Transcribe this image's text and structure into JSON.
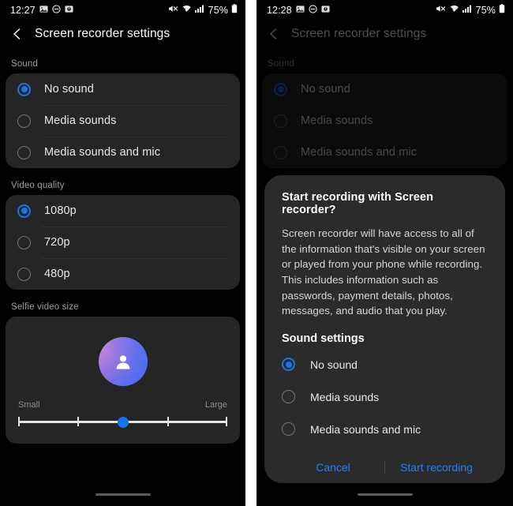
{
  "panels": {
    "left": {
      "status_bar": {
        "time": "12:27",
        "icons": [
          "image-icon",
          "do-not-disturb-icon",
          "alarm-icon"
        ],
        "right_icons": [
          "mute-icon",
          "wifi-icon",
          "signal-icon"
        ],
        "battery": "75%"
      },
      "header": {
        "back_icon": "back-chevron-icon",
        "title": "Screen recorder settings"
      },
      "sections": [
        {
          "label": "Sound",
          "options": [
            {
              "label": "No sound",
              "selected": true
            },
            {
              "label": "Media sounds",
              "selected": false
            },
            {
              "label": "Media sounds and mic",
              "selected": false
            }
          ]
        },
        {
          "label": "Video quality",
          "options": [
            {
              "label": "1080p",
              "selected": true
            },
            {
              "label": "720p",
              "selected": false
            },
            {
              "label": "480p",
              "selected": false
            }
          ]
        }
      ],
      "selfie": {
        "label": "Selfie video size",
        "avatar_icon": "person-avatar-icon",
        "min_label": "Small",
        "max_label": "Large",
        "value": 2,
        "min": 1,
        "max": 4
      }
    },
    "right": {
      "status_bar": {
        "time": "12:28",
        "icons": [
          "image-icon",
          "do-not-disturb-icon",
          "alarm-icon"
        ],
        "right_icons": [
          "mute-icon",
          "wifi-icon",
          "signal-icon"
        ],
        "battery": "75%"
      },
      "header": {
        "back_icon": "back-chevron-icon",
        "title": "Screen recorder settings"
      },
      "background_section_label": "Sound",
      "background_options": [
        {
          "label": "No sound",
          "selected": true
        },
        {
          "label": "Media sounds",
          "selected": false
        },
        {
          "label": "Media sounds and mic",
          "selected": false
        }
      ],
      "dialog": {
        "title": "Start recording with Screen recorder?",
        "body": "Screen recorder will have access to all of the information that's visible on your screen or played from your phone while recording. This includes information such as passwords, payment details, photos, messages, and audio that you play.",
        "sound_settings_title": "Sound settings",
        "options": [
          {
            "label": "No sound",
            "selected": true
          },
          {
            "label": "Media sounds",
            "selected": false
          },
          {
            "label": "Media sounds and mic",
            "selected": false
          }
        ],
        "cancel_label": "Cancel",
        "confirm_label": "Start recording"
      }
    }
  },
  "colors": {
    "accent": "#1a73e8",
    "link": "#2f7ce8",
    "card": "#252525",
    "dialog": "#2b2b2b",
    "background": "#000000"
  }
}
